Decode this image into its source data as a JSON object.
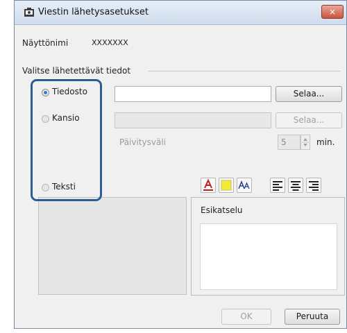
{
  "window": {
    "title": "Viestin lähetysasetukset",
    "close_label": "×"
  },
  "display_name": {
    "label": "Näyttönimi",
    "value": "XXXXXXX"
  },
  "section_label": "Valitse lähetettävät tiedot",
  "options": {
    "file": {
      "label": "Tiedosto",
      "browse": "Selaa..."
    },
    "folder": {
      "label": "Kansio",
      "browse": "Selaa..."
    },
    "text": {
      "label": "Teksti"
    }
  },
  "update_interval": {
    "label": "Päivitysväli",
    "value": "5",
    "unit": "min."
  },
  "preview": {
    "label": "Esikatselu"
  },
  "buttons": {
    "ok": "OK",
    "cancel": "Peruuta"
  },
  "colors": {
    "highlight": "#2b5d93",
    "close_button": "#c8553e",
    "selected_radio": "#2e7bd8"
  }
}
